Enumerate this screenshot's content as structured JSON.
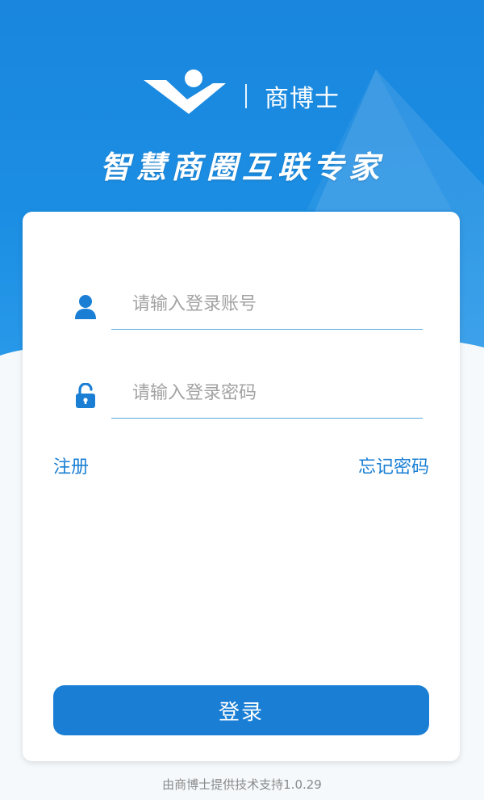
{
  "brand": {
    "name": "商博士",
    "slogan": "智慧商圈互联专家",
    "logo_icon": "brand-logo-icon"
  },
  "login_form": {
    "account_placeholder": "请输入登录账号",
    "password_placeholder": "请输入登录密码",
    "account_value": "",
    "password_value": "",
    "account_icon": "user-icon",
    "password_icon": "lock-icon",
    "register_label": "注册",
    "forgot_label": "忘记密码",
    "submit_label": "登录"
  },
  "footer": {
    "text": "由商博士提供技术支持1.0.29"
  },
  "colors": {
    "primary": "#1a7fd4",
    "hero": "#1b8ee3",
    "input_underline": "#5aa7df",
    "placeholder": "#a3a3a3"
  }
}
